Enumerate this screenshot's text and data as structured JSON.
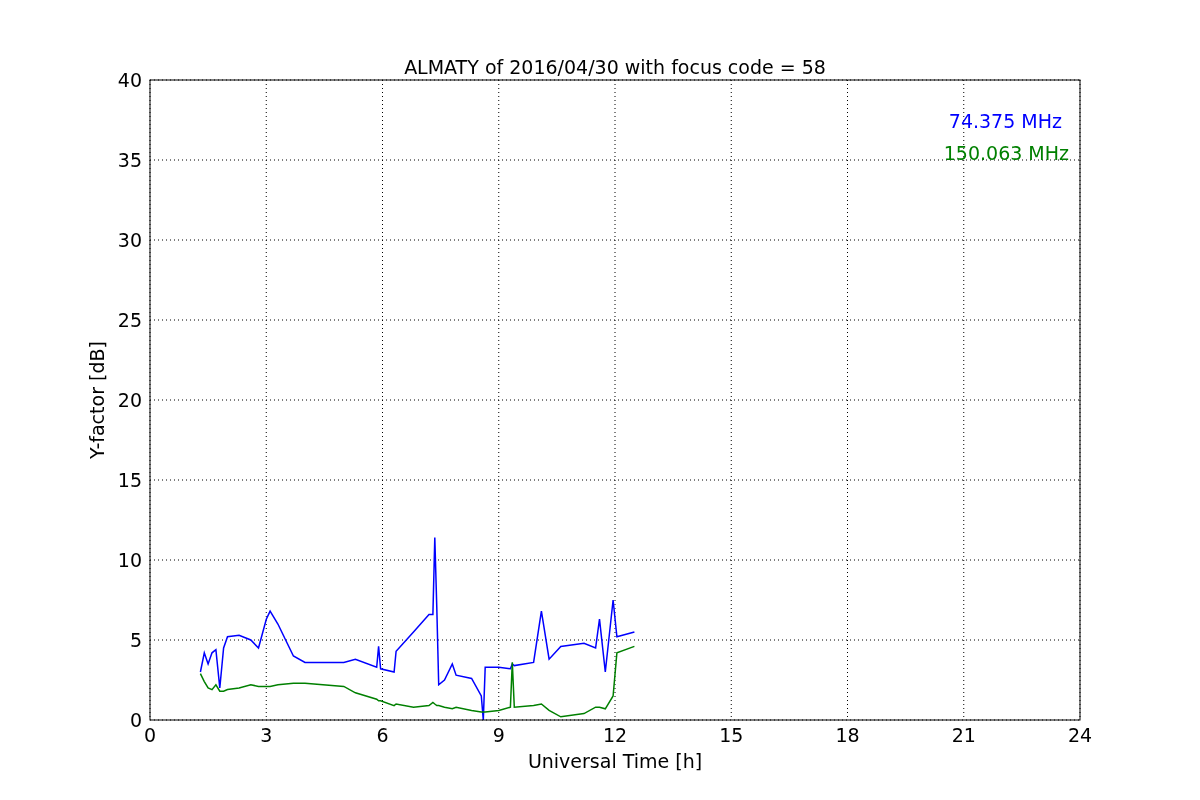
{
  "chart_data": {
    "type": "line",
    "title": "ALMATY of 2016/04/30 with focus code = 58",
    "xlabel": "Universal Time [h]",
    "ylabel": "Y-factor [dB]",
    "x": [
      1.3,
      1.4,
      1.5,
      1.6,
      1.7,
      1.8,
      1.9,
      2.0,
      2.3,
      2.6,
      2.8,
      3.0,
      3.1,
      3.3,
      3.7,
      4.0,
      5.0,
      5.3,
      5.85,
      5.9,
      5.95,
      6.3,
      6.35,
      6.8,
      7.2,
      7.3,
      7.35,
      7.4,
      7.45,
      7.6,
      7.8,
      7.9,
      8.3,
      8.55,
      8.6,
      8.65,
      9.0,
      9.3,
      9.35,
      9.4,
      9.9,
      10.1,
      10.3,
      10.6,
      11.2,
      11.5,
      11.6,
      11.75,
      11.95,
      12.05,
      12.5
    ],
    "series": [
      {
        "name": "74.375 MHz",
        "color": "#0000ff",
        "values": [
          3.0,
          4.2,
          3.5,
          4.2,
          4.4,
          2.0,
          4.5,
          5.2,
          5.3,
          5.0,
          4.5,
          6.3,
          6.8,
          6.0,
          4.0,
          3.6,
          3.6,
          3.8,
          3.3,
          4.6,
          3.2,
          3.0,
          4.3,
          5.5,
          6.6,
          6.6,
          11.4,
          7.0,
          2.2,
          2.5,
          3.5,
          2.8,
          2.6,
          1.5,
          0,
          3.3,
          3.3,
          3.2,
          3.5,
          3.4,
          3.6,
          6.8,
          3.8,
          4.6,
          4.8,
          4.5,
          6.3,
          3.0,
          7.5,
          5.2,
          5.5
        ]
      },
      {
        "name": "150.063 MHz",
        "color": "#008000",
        "values": [
          2.9,
          2.4,
          2.0,
          1.9,
          2.2,
          1.8,
          1.8,
          1.9,
          2.0,
          2.2,
          2.1,
          2.1,
          2.1,
          2.2,
          2.3,
          2.3,
          2.1,
          1.7,
          1.3,
          1.2,
          1.2,
          0.9,
          1.0,
          0.8,
          0.9,
          1.1,
          1.0,
          0.9,
          0.9,
          0.8,
          0.7,
          0.8,
          0.6,
          0.5,
          0.5,
          0.5,
          0.6,
          0.8,
          3.6,
          0.8,
          0.9,
          1.0,
          0.6,
          0.2,
          0.4,
          0.8,
          0.8,
          0.7,
          1.5,
          4.2,
          4.6
        ]
      }
    ],
    "xlim": [
      0,
      24
    ],
    "ylim": [
      0,
      40
    ],
    "xticks": [
      0,
      3,
      6,
      9,
      12,
      15,
      18,
      21,
      24
    ],
    "yticks": [
      0,
      5,
      10,
      15,
      20,
      25,
      30,
      35,
      40
    ],
    "grid": true
  }
}
